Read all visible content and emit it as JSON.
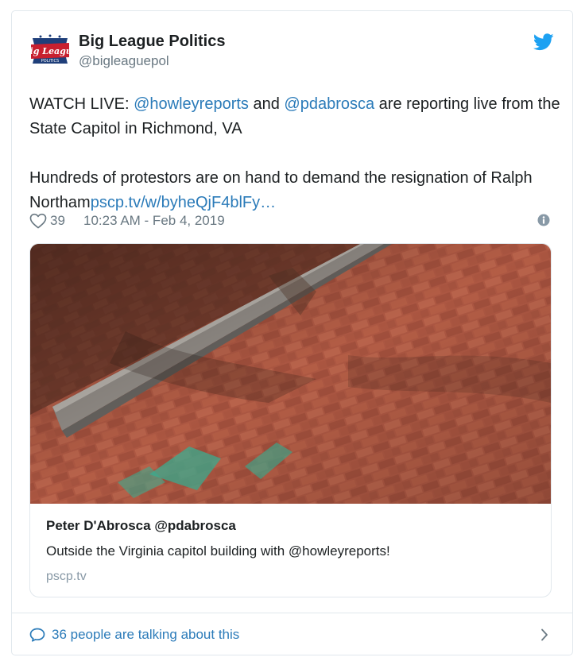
{
  "author": {
    "name": "Big League Politics",
    "handle": "@bigleaguepol",
    "avatar_text": "Big League",
    "avatar_subtext": "POLITICS"
  },
  "tweet": {
    "p1_prefix": "WATCH LIVE: ",
    "mention1": "@howleyreports",
    "p1_middle": " and ",
    "mention2": "@pdabrosca",
    "p1_suffix": " are reporting live from the State Capitol in Richmond, VA",
    "p2_text": "Hundreds of protestors are on hand to demand the resignation of Ralph Northam",
    "link": "pscp.tv/w/byheQjF4blFy…"
  },
  "meta": {
    "likes": "39",
    "timestamp": "10:23 AM - Feb 4, 2019"
  },
  "card": {
    "title": "Peter D'Abrosca @pdabrosca",
    "description": "Outside the Virginia capitol building with @howleyreports!",
    "domain": "pscp.tv"
  },
  "footer": {
    "talking": "36 people are talking about this"
  },
  "colors": {
    "link": "#2b7bb9",
    "twitter_blue": "#1da1f2",
    "muted": "#697882",
    "border": "#e1e8ed",
    "brick": "#b05a44"
  },
  "icons": {
    "bird": "twitter-bird-icon",
    "like": "heart-icon",
    "info": "info-icon",
    "talking": "speech-bubble-icon",
    "chevron": "chevron-right-icon"
  }
}
